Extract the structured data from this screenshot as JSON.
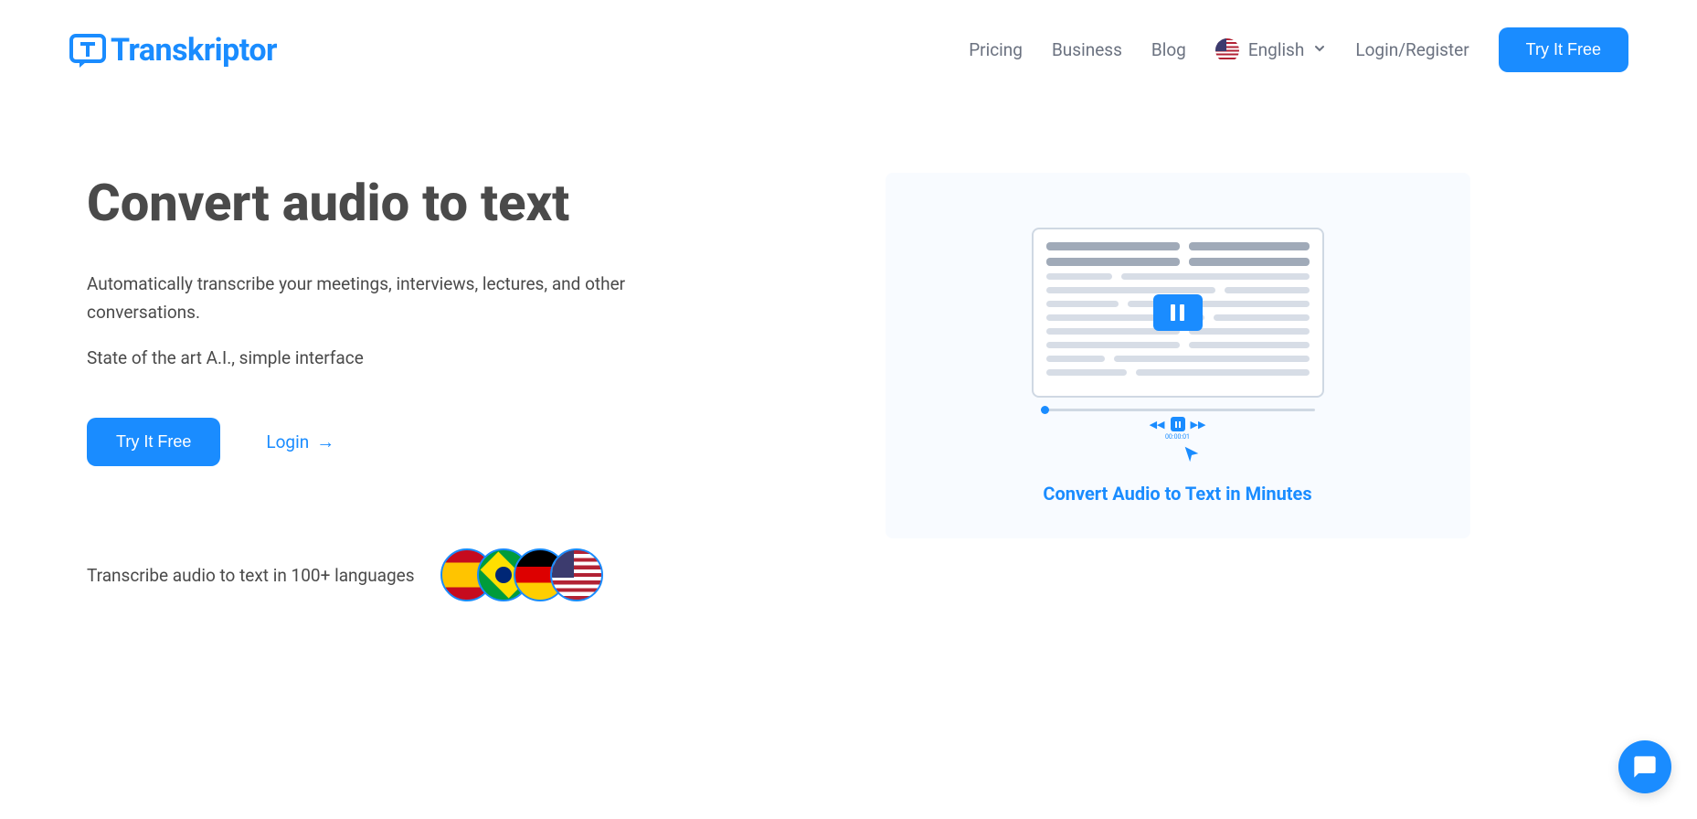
{
  "brand": {
    "name": "Transkriptor"
  },
  "nav": {
    "pricing": "Pricing",
    "business": "Business",
    "blog": "Blog",
    "language": "English",
    "login_register": "Login/Register",
    "cta": "Try It Free"
  },
  "hero": {
    "title": "Convert audio to text",
    "desc": "Automatically transcribe your meetings, interviews, lectures, and other conversations.",
    "desc2": "State of the art A.I., simple interface",
    "cta": "Try It Free",
    "login": "Login",
    "languages_text": "Transcribe audio to text in 100+ languages"
  },
  "illustration": {
    "timestamp": "00:00:01",
    "caption": "Convert Audio to Text in Minutes"
  }
}
